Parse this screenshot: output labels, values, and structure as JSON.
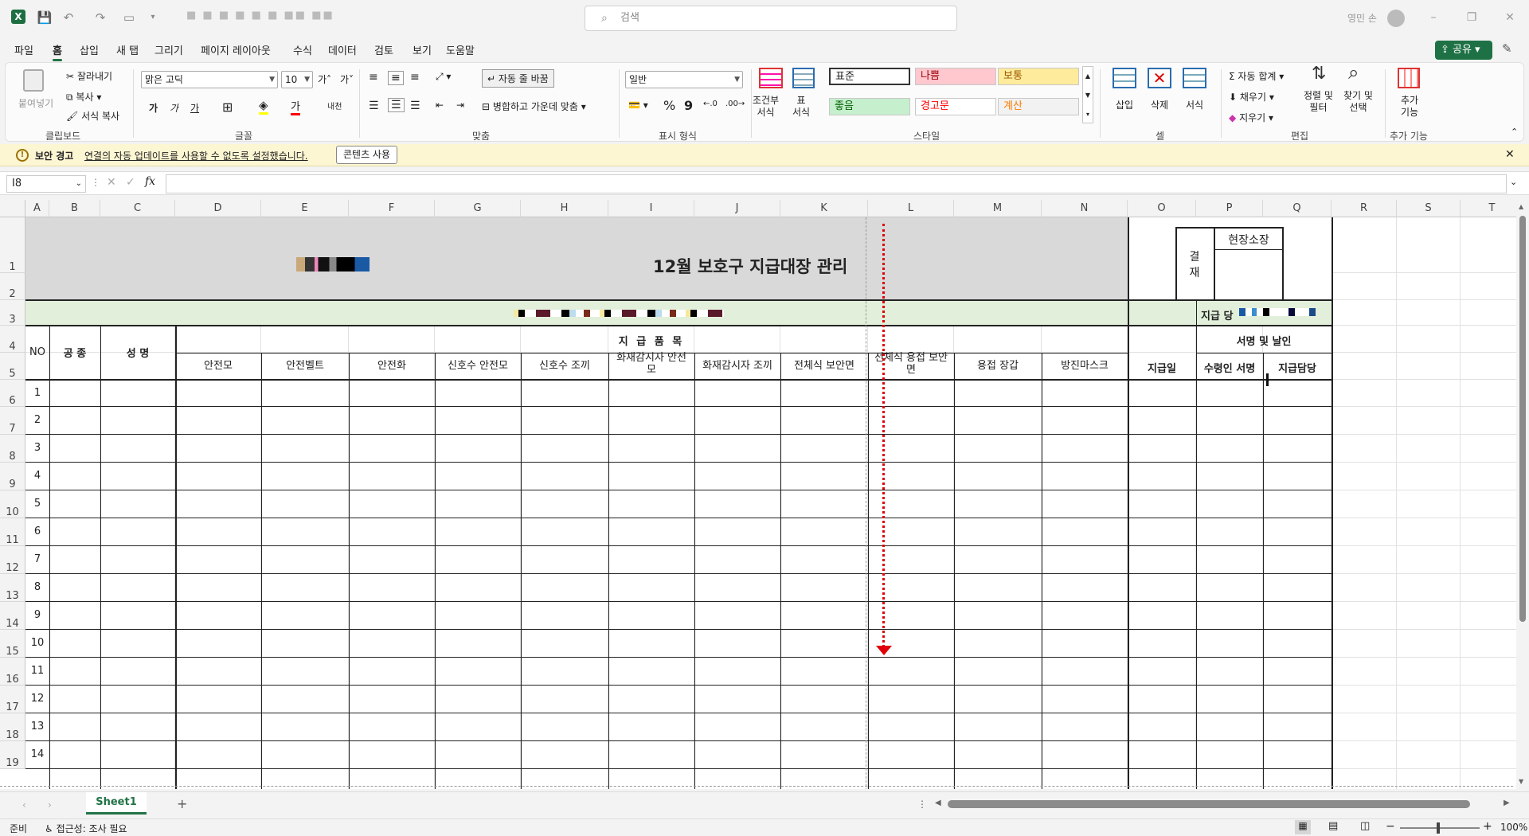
{
  "app": {
    "title_blurred": "■ ■ ■ ■ ■ ■ ■■ ■■",
    "user": "영민 손",
    "search_placeholder": "검색"
  },
  "menu": [
    "파일",
    "홈",
    "삽입",
    "새 탭",
    "그리기",
    "페이지 레이아웃",
    "수식",
    "데이터",
    "검토",
    "보기",
    "도움말"
  ],
  "share_label": "공유",
  "ribbon": {
    "clipboard": {
      "paste": "붙여넣기",
      "cut": "잘라내기",
      "copy": "복사",
      "format_painter": "서식 복사",
      "label": "클립보드"
    },
    "font": {
      "name": "맑은 고딕",
      "size": "10",
      "label": "글꼴",
      "bold": "가",
      "italic": "가",
      "underline": "가"
    },
    "align": {
      "wrap": "자동 줄 바꿈",
      "merge": "병합하고 가운데 맞춤",
      "label": "맞춤"
    },
    "number": {
      "format": "일반",
      "label": "표시 형식",
      "percent": "%",
      "comma": "9"
    },
    "styles": {
      "cond": "조건부\n서식",
      "table": "표\n서식",
      "label": "스타일",
      "cells": [
        {
          "text": "표준",
          "bg": "#ffffff",
          "color": "#222222"
        },
        {
          "text": "나쁨",
          "bg": "#ffc7ce",
          "color": "#9c0006"
        },
        {
          "text": "보통",
          "bg": "#ffeb9c",
          "color": "#9c5700"
        },
        {
          "text": "좋음",
          "bg": "#c6efce",
          "color": "#006100"
        },
        {
          "text": "경고문",
          "bg": "#ffffff",
          "color": "#ff0000"
        },
        {
          "text": "계산",
          "bg": "#f2f2f2",
          "color": "#fa7d00"
        }
      ]
    },
    "cells_group": {
      "insert": "삽입",
      "delete": "삭제",
      "format": "서식",
      "label": "셀"
    },
    "editing": {
      "autosum": "자동 합계",
      "fill": "채우기",
      "clear": "지우기",
      "sort": "정렬 및\n필터",
      "find": "찾기 및\n선택",
      "label": "편집"
    },
    "addins": {
      "btn": "추가\n기능",
      "label": "추가 기능"
    }
  },
  "warning": {
    "title": "보안 경고",
    "message": "연결의 자동 업데이트를 사용할 수 없도록 설정했습니다.",
    "button": "콘텐츠 사용"
  },
  "formula": {
    "namebox": "I8",
    "fx": "fx",
    "value": ""
  },
  "columns": [
    "A",
    "B",
    "C",
    "D",
    "E",
    "F",
    "G",
    "H",
    "I",
    "J",
    "K",
    "L",
    "M",
    "N",
    "O",
    "P",
    "Q",
    "R",
    "S",
    "T"
  ],
  "rows": [
    "1",
    "2",
    "3",
    "4",
    "5",
    "6",
    "7",
    "8",
    "9",
    "10",
    "11",
    "12",
    "13",
    "14",
    "15",
    "16",
    "17",
    "18",
    "19"
  ],
  "sheet": {
    "title": "12월 보호구 지급대장 관리",
    "approval_label": "결\n재",
    "approval_role": "현장소장",
    "date_label": "지급 당",
    "no_header": "NO",
    "trade_header": "공 종",
    "name_header": "성 명",
    "items_header": "지 급 품 목",
    "items": [
      "안전모",
      "안전벨트",
      "안전화",
      "신호수 안전모",
      "신호수 조끼",
      "화재감시자 안전\n모",
      "화재감시자 조끼",
      "전체식 보안면",
      "전체식 용접 보안\n면",
      "용접 장갑",
      "방진마스크"
    ],
    "date_header": "지급일",
    "sign_header": "서명 및 날인",
    "recipient_header": "수령인 서명",
    "manager_header": "지급담당",
    "numbers": [
      "1",
      "2",
      "3",
      "4",
      "5",
      "6",
      "7",
      "8",
      "9",
      "10",
      "11",
      "12",
      "13",
      "14"
    ]
  },
  "tabs": {
    "sheet": "Sheet1",
    "add": "+"
  },
  "status": {
    "ready": "준비",
    "accessibility": "접근성: 조사 필요",
    "zoom": "100%"
  },
  "colors": {
    "accent": "#217346",
    "header_fill": "#d9d9d9",
    "band_fill": "#e2efda",
    "page_break": "#e0000a"
  }
}
